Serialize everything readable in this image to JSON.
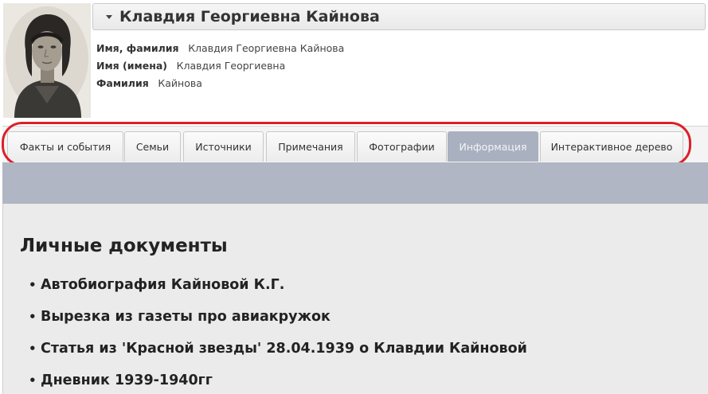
{
  "person": {
    "full_name": "Клавдия Георгиевна Кайнова",
    "fields": [
      {
        "label": "Имя, фамилия",
        "value": "Клавдия Георгиевна Кайнова"
      },
      {
        "label": "Имя (имена)",
        "value": "Клавдия Георгиевна"
      },
      {
        "label": "Фамилия",
        "value": "Кайнова"
      }
    ]
  },
  "tabs": [
    {
      "label": "Факты и события",
      "active": false
    },
    {
      "label": "Семьи",
      "active": false
    },
    {
      "label": "Источники",
      "active": false
    },
    {
      "label": "Примечания",
      "active": false
    },
    {
      "label": "Фотографии",
      "active": false
    },
    {
      "label": "Информация",
      "active": true
    },
    {
      "label": "Интерактивное дерево",
      "active": false
    }
  ],
  "content": {
    "heading": "Личные документы",
    "bullet": "•",
    "documents": [
      "Автобиография Кайновой К.Г.",
      "Вырезка из газеты про авиакружок",
      "Статья из 'Красной звезды' 28.04.1939 о Клавдии Кайновой",
      "Дневник 1939-1940гг"
    ]
  },
  "colors": {
    "active_tab": "#a9b0c0",
    "band": "#b1b6c4",
    "annotation_outline": "#dc1f28"
  }
}
